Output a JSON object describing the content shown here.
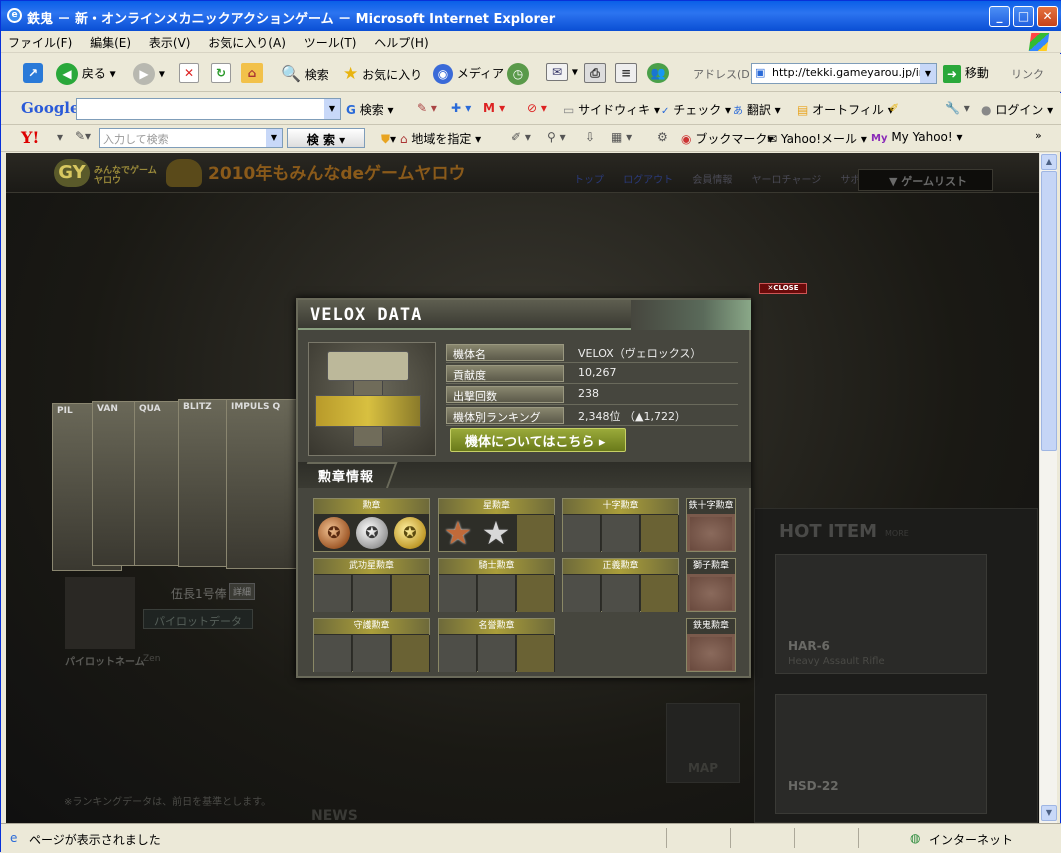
{
  "window": {
    "title": "鉄鬼 － 新・オンラインメカニックアクションゲーム － Microsoft Internet Explorer"
  },
  "menubar": [
    "ファイル(F)",
    "編集(E)",
    "表示(V)",
    "お気に入り(A)",
    "ツール(T)",
    "ヘルプ(H)"
  ],
  "toolbar": {
    "back": "戻る",
    "search": "検索",
    "favorites": "お気に入り",
    "media": "メディア",
    "address_label": "アドレス(D)",
    "address_value": "http://tekki.gameyarou.jp/inc",
    "go": "移動",
    "links": "リンク"
  },
  "google_bar": {
    "logo": "Google",
    "search": "検索",
    "sidewiki": "サイドウィキ",
    "check": "チェック",
    "translate": "翻訳",
    "autofill": "オートフィル",
    "login": "ログイン"
  },
  "yahoo_bar": {
    "logo": "Y!",
    "placeholder": "入力して検索",
    "search_btn": "検 索",
    "region": "地域を指定",
    "bookmark": "ブックマーク",
    "mail": "Yahoo!メール",
    "myyahoo": "My Yahoo!"
  },
  "site_header": {
    "logo_sub": "みんなでゲームヤロウ",
    "slogan": "2010年もみんなdeゲームヤロウ",
    "nav": [
      "トップ",
      "ログアウト",
      "会員情報",
      "ヤーロチャージ",
      "サポート"
    ],
    "gamelist": "ゲームリスト"
  },
  "pilot_cards": [
    "PIL",
    "VAN",
    "QUA",
    "BLITZ",
    "IMPULS Q"
  ],
  "pilot": {
    "rank": "伍長1号俸",
    "detail": "詳細",
    "data_button": "パイロットデータ",
    "name_label": "パイロットネーム",
    "name_value": "Zen",
    "note": "※ランキングデータは、前日を基準とします。"
  },
  "hot_item": {
    "title": "HOT ITEM",
    "more": "MORE",
    "items": [
      {
        "name": "HAR-6",
        "desc": "Heavy Assault Rifle"
      },
      {
        "name": "HSD-22",
        "desc": ""
      }
    ]
  },
  "map_label": "MAP",
  "news_label": "NEWS",
  "modal": {
    "close": "✕CLOSE",
    "title": "VELOX DATA",
    "info": [
      {
        "label": "機体名",
        "value": "VELOX（ヴェロックス）"
      },
      {
        "label": "貢献度",
        "value": "10,267"
      },
      {
        "label": "出撃回数",
        "value": "238"
      },
      {
        "label": "機体別ランキング",
        "value": "2,348位 （▲1,722）"
      }
    ],
    "about_button": "機体についてはこちら ▸",
    "medal_header": "勲章情報",
    "medals": {
      "kunsho": "勲章",
      "hoshi": "星勲章",
      "juji": "十字勲章",
      "tetsujuji": "鉄十字勲章",
      "bukou": "武功星勲章",
      "kishi": "騎士勲章",
      "seigi": "正義勲章",
      "shishi": "獅子勲章",
      "shugo": "守護勲章",
      "meiyo": "名誉勲章",
      "tekki": "鉄鬼勲章"
    }
  },
  "status": {
    "text": "ページが表示されました",
    "zone": "インターネット"
  }
}
